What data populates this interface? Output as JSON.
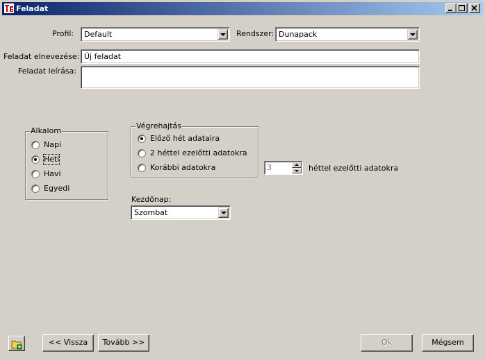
{
  "window": {
    "title": "Feladat"
  },
  "profile": {
    "label": "Profil:",
    "value": "Default"
  },
  "system": {
    "label": "Rendszer:",
    "value": "Dunapack"
  },
  "task_name": {
    "label": "Feladat elnevezése:",
    "value": "Új feladat"
  },
  "task_description": {
    "label": "Feladat leírása:",
    "value": ""
  },
  "occasion": {
    "legend": "Alkalom",
    "options": [
      "Napi",
      "Heti",
      "Havi",
      "Egyedi"
    ],
    "selected": "Heti"
  },
  "execution": {
    "legend": "Végrehajtás",
    "options": [
      "Előző hét adataira",
      "2 héttel ezelőtti adatokra",
      "Korábbi adatokra"
    ],
    "selected": "Előző hét adataira",
    "weeks_value": "3",
    "weeks_suffix": "héttel ezelőtti adatokra"
  },
  "start_day": {
    "label": "Kezdőnap:",
    "value": "Szombat"
  },
  "buttons": {
    "back": "<< Vissza",
    "next": "Tovább >>",
    "ok": "Ok",
    "cancel": "Mégsem"
  },
  "colors": {
    "titlebar_start": "#0a246a",
    "titlebar_end": "#a6caf0",
    "face": "#d4d0c8"
  },
  "icons": {
    "app": "app-logo-icon",
    "save": "folder-save-icon"
  }
}
